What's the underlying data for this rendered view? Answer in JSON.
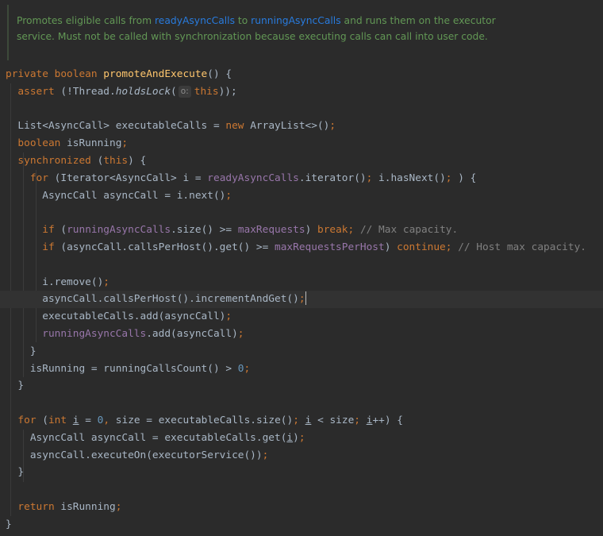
{
  "doc": {
    "p1": "Promotes eligible calls from ",
    "link1": "readyAsyncCalls",
    "p2": " to ",
    "link2": "runningAsyncCalls",
    "p3": " and runs them on the executor service. Must not be called with synchronization because executing calls can call into user code."
  },
  "code": {
    "l1": {
      "a": "private boolean ",
      "b": "promoteAndExecute",
      "c": "() {"
    },
    "l2": {
      "a": "assert ",
      "b": "(!Thread.",
      "c": "holdsLock",
      "d": "(",
      "hint": "o:",
      "e": "this",
      "f": "));"
    },
    "l4": {
      "a": "List<AsyncCall> executableCalls = ",
      "b": "new ",
      "c": "ArrayList<>()",
      "d": ";"
    },
    "l5": {
      "a": "boolean ",
      "b": "isRunning",
      "c": ";"
    },
    "l6": {
      "a": "synchronized ",
      "b": "(",
      "c": "this",
      "d": ") {"
    },
    "l7": {
      "a": "for ",
      "b": "(Iterator<AsyncCall> i = ",
      "c": "readyAsyncCalls",
      "d": ".iterator()",
      "e": "; ",
      "f": "i.hasNext()",
      "g": "; ",
      "h": ") {"
    },
    "l8": {
      "a": "AsyncCall asyncCall = i.next()",
      "b": ";"
    },
    "l10": {
      "a": "if ",
      "b": "(",
      "c": "runningAsyncCalls",
      "d": ".size() >= ",
      "e": "maxRequests",
      "f": ") ",
      "g": "break",
      "h": "; ",
      "i": "// Max capacity."
    },
    "l11": {
      "a": "if ",
      "b": "(asyncCall.callsPerHost().get() >= ",
      "c": "maxRequestsPerHost",
      "d": ") ",
      "e": "continue",
      "f": "; ",
      "g": "// Host max capacity."
    },
    "l13": {
      "a": "i.remove()",
      "b": ";"
    },
    "l14": {
      "a": "asyncCall.callsPerHost().incrementAndGet()",
      "b": ";"
    },
    "l15": {
      "a": "executableCalls.add(asyncCall)",
      "b": ";"
    },
    "l16": {
      "a": "runningAsyncCalls",
      "b": ".add(asyncCall)",
      "c": ";"
    },
    "l17": {
      "a": "}"
    },
    "l18": {
      "a": "isRunning = runningCallsCount() > ",
      "b": "0",
      "c": ";"
    },
    "l19": {
      "a": "}"
    },
    "l21": {
      "a": "for ",
      "b": "(",
      "c": "int ",
      "d": "i",
      "e": " = ",
      "f": "0",
      "g": ", ",
      "h": "size = executableCalls.size()",
      "i": "; ",
      "j": "i",
      "k": " < size",
      "l": "; ",
      "m": "i",
      "n": "++) {"
    },
    "l22": {
      "a": "AsyncCall asyncCall = executableCalls.get(",
      "b": "i",
      "c": ")",
      "d": ";"
    },
    "l23": {
      "a": "asyncCall.executeOn(executorService())",
      "b": ";"
    },
    "l24": {
      "a": "}"
    },
    "l26": {
      "a": "return ",
      "b": "isRunning",
      "c": ";"
    },
    "l27": {
      "a": "}"
    }
  }
}
